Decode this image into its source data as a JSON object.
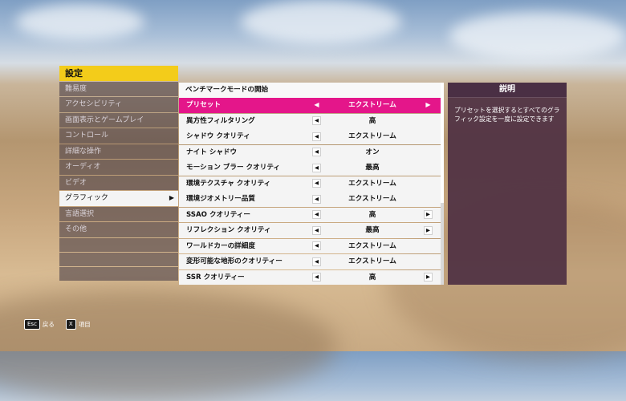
{
  "sidebar": {
    "title": "設定",
    "items": [
      {
        "label": "難易度",
        "active": false
      },
      {
        "label": "アクセシビリティ",
        "active": false
      },
      {
        "label": "画面表示とゲームプレイ",
        "active": false
      },
      {
        "label": "コントロール",
        "active": false
      },
      {
        "label": "詳細な操作",
        "active": false
      },
      {
        "label": "オーディオ",
        "active": false
      },
      {
        "label": "ビデオ",
        "active": false
      },
      {
        "label": "グラフィック",
        "active": true
      },
      {
        "label": "言語選択",
        "active": false
      },
      {
        "label": "その他",
        "active": false
      }
    ],
    "active_arrow": "▶"
  },
  "main": {
    "header": "ベンチマークモードの開始",
    "rows": [
      {
        "label": "プリセット",
        "value": "エクストリーム",
        "selected": true,
        "right_arrow": true
      },
      {
        "label": "異方性フィルタリング",
        "value": "高",
        "right_arrow": false
      },
      {
        "label": "シャドウ クオリティ",
        "value": "エクストリーム",
        "right_arrow": false
      },
      {
        "label": "ナイト シャドウ",
        "value": "オン",
        "right_arrow": false
      },
      {
        "label": "モーション ブラー クオリティ",
        "value": "最高",
        "right_arrow": false
      },
      {
        "label": "環境テクスチャ クオリティ",
        "value": "エクストリーム",
        "right_arrow": false
      },
      {
        "label": "環境ジオメトリー品質",
        "value": "エクストリーム",
        "right_arrow": false
      },
      {
        "label": "SSAO クオリティー",
        "value": "高",
        "right_arrow": true
      },
      {
        "label": "リフレクション クオリティ",
        "value": "最高",
        "right_arrow": true
      },
      {
        "label": "ワールドカーの詳細度",
        "value": "エクストリーム",
        "right_arrow": false
      },
      {
        "label": "変形可能な地形のクオリティー",
        "value": "エクストリーム",
        "right_arrow": false
      },
      {
        "label": "SSR クオリティー",
        "value": "高",
        "right_arrow": true
      }
    ],
    "left_arrow": "◀",
    "right_arrow": "▶"
  },
  "description": {
    "title": "説明",
    "text": "プリセットを選択するとすべてのグラフィック設定を一度に設定できます"
  },
  "footer": {
    "back_key": "Esc",
    "back_label": "戻る",
    "item_key": "X",
    "item_label": "項目"
  },
  "colors": {
    "accent_yellow": "#f3cc1a",
    "selected_pink": "#e4168a",
    "panel_purple": "#4e3042"
  }
}
